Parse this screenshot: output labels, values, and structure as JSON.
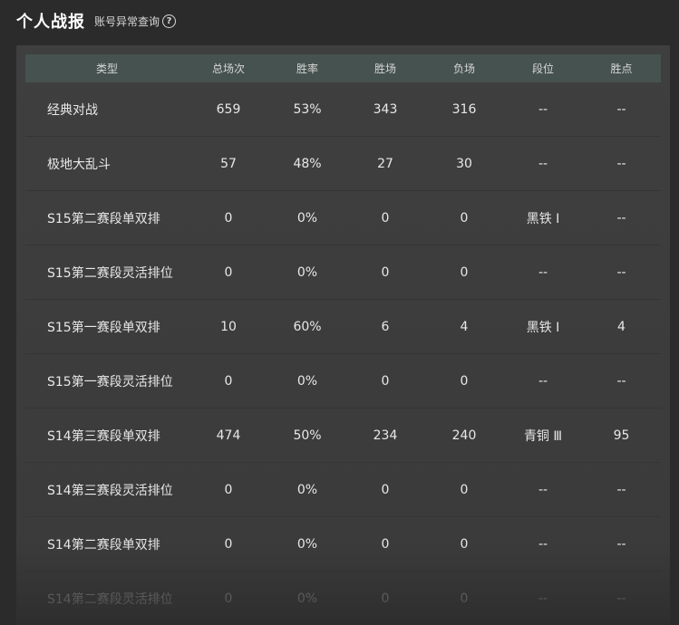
{
  "header": {
    "title": "个人战报",
    "link_label": "账号异常查询",
    "help_icon": "?"
  },
  "table": {
    "columns": [
      "类型",
      "总场次",
      "胜率",
      "胜场",
      "负场",
      "段位",
      "胜点"
    ],
    "rows": [
      [
        "经典对战",
        "659",
        "53%",
        "343",
        "316",
        "--",
        "--"
      ],
      [
        "极地大乱斗",
        "57",
        "48%",
        "27",
        "30",
        "--",
        "--"
      ],
      [
        "S15第二赛段单双排",
        "0",
        "0%",
        "0",
        "0",
        "黑铁 Ⅰ",
        "--"
      ],
      [
        "S15第二赛段灵活排位",
        "0",
        "0%",
        "0",
        "0",
        "--",
        "--"
      ],
      [
        "S15第一赛段单双排",
        "10",
        "60%",
        "6",
        "4",
        "黑铁 Ⅰ",
        "4"
      ],
      [
        "S15第一赛段灵活排位",
        "0",
        "0%",
        "0",
        "0",
        "--",
        "--"
      ],
      [
        "S14第三赛段单双排",
        "474",
        "50%",
        "234",
        "240",
        "青铜 Ⅲ",
        "95"
      ],
      [
        "S14第三赛段灵活排位",
        "0",
        "0%",
        "0",
        "0",
        "--",
        "--"
      ],
      [
        "S14第二赛段单双排",
        "0",
        "0%",
        "0",
        "0",
        "--",
        "--"
      ],
      [
        "S14第二赛段灵活排位",
        "0",
        "0%",
        "0",
        "0",
        "--",
        "--"
      ]
    ]
  }
}
